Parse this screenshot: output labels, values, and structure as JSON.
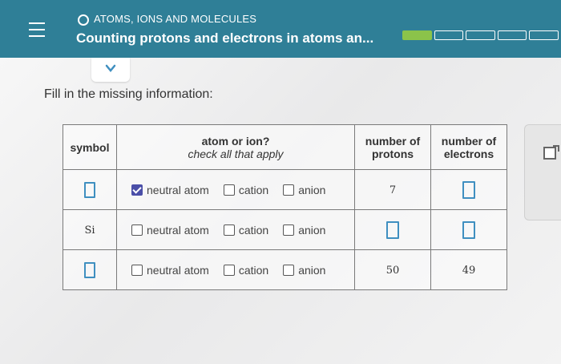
{
  "header": {
    "topic": "ATOMS, IONS AND MOLECULES",
    "title": "Counting protons and electrons in atoms an...",
    "progress": {
      "segments": 5,
      "filled": 1
    }
  },
  "instruction": "Fill in the missing information:",
  "table": {
    "headers": {
      "symbol": "symbol",
      "atom_title": "atom or ion?",
      "atom_sub": "check all that apply",
      "protons_1": "number of",
      "protons_2": "protons",
      "electrons_1": "number of",
      "electrons_2": "electrons"
    },
    "options": [
      "neutral atom",
      "cation",
      "anion"
    ],
    "rows": [
      {
        "symbol": "",
        "checked": [
          true,
          false,
          false
        ],
        "protons": "7",
        "electrons": ""
      },
      {
        "symbol": "Si",
        "checked": [
          false,
          false,
          false
        ],
        "protons": "",
        "electrons": ""
      },
      {
        "symbol": "",
        "checked": [
          false,
          false,
          false
        ],
        "protons": "50",
        "electrons": "49"
      }
    ]
  },
  "colors": {
    "header_bg": "#2f7f97",
    "progress_fill": "#8bc34a",
    "checkbox_checked": "#4b4fa8",
    "input_box": "#3f8fc0"
  },
  "icons": {
    "menu": "hamburger-menu-icon",
    "collapse": "chevron-down-icon",
    "topic": "circle-dot-icon",
    "side": "checkbox-expand-icon"
  }
}
